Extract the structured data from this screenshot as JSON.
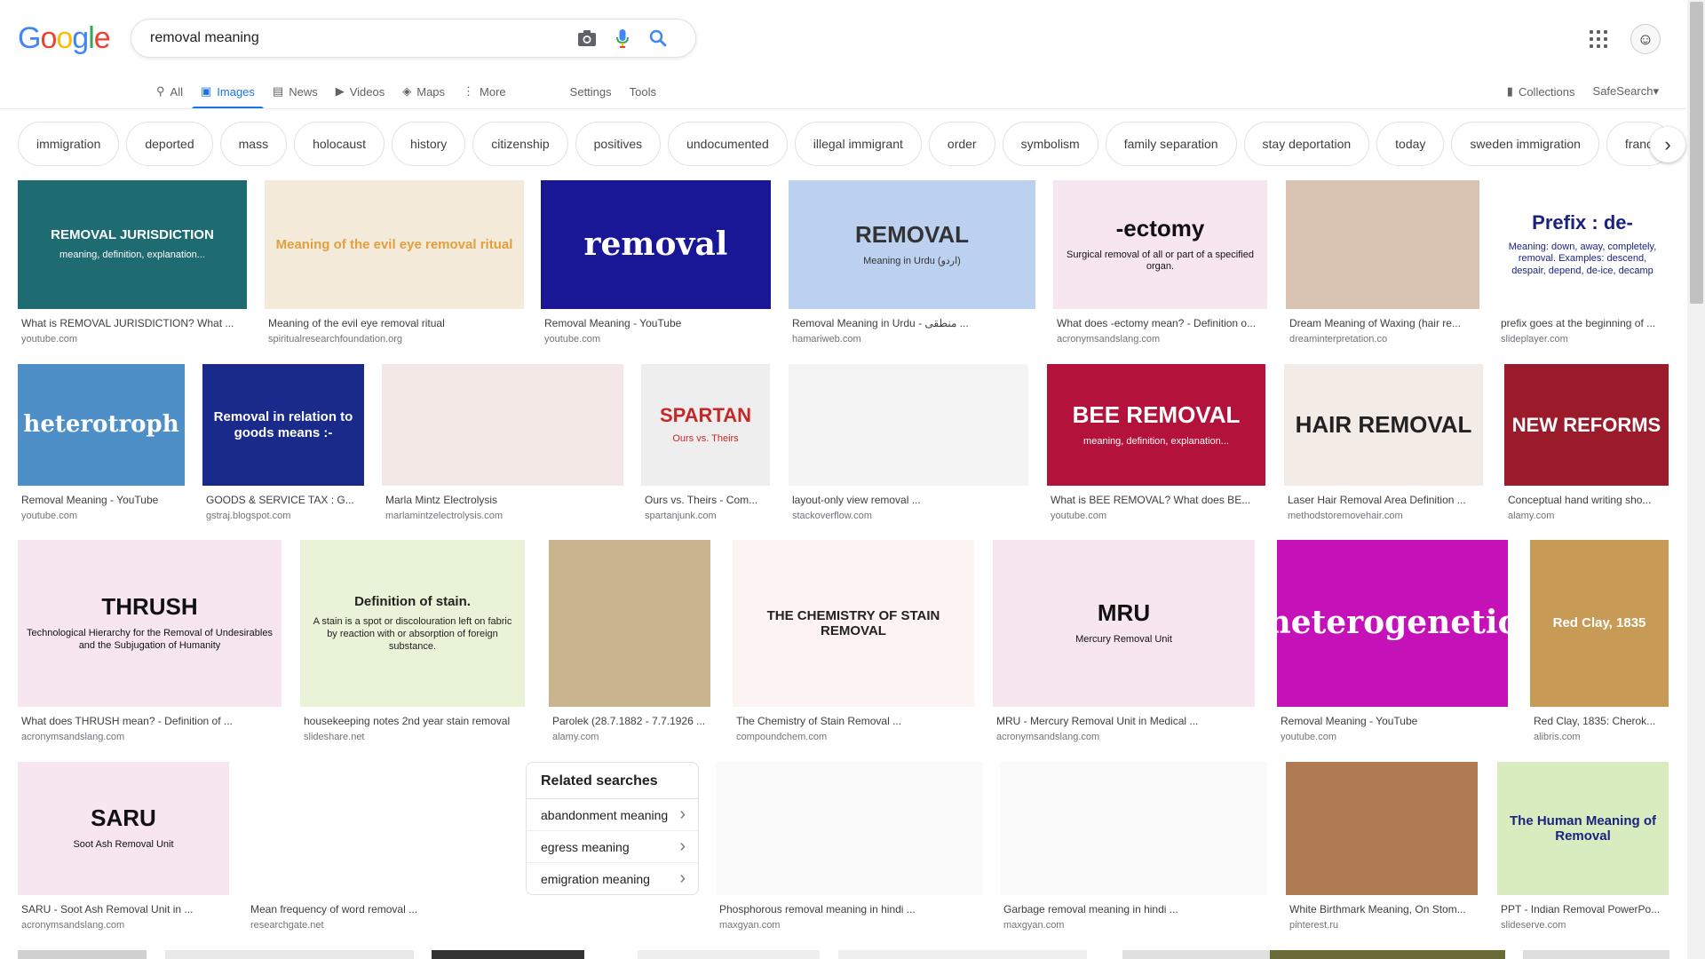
{
  "search": {
    "query": "removal meaning"
  },
  "logo": {
    "letters": [
      {
        "ch": "G",
        "color": "#4285F4"
      },
      {
        "ch": "o",
        "color": "#EA4335"
      },
      {
        "ch": "o",
        "color": "#FBBC05"
      },
      {
        "ch": "g",
        "color": "#4285F4"
      },
      {
        "ch": "l",
        "color": "#34A853"
      },
      {
        "ch": "e",
        "color": "#EA4335"
      }
    ]
  },
  "tabs": {
    "all": "All",
    "images": "Images",
    "news": "News",
    "videos": "Videos",
    "maps": "Maps",
    "more": "More",
    "settings": "Settings",
    "tools": "Tools",
    "collections": "Collections",
    "safesearch": "SafeSearch"
  },
  "chips": [
    "immigration",
    "deported",
    "mass",
    "holocaust",
    "history",
    "citizenship",
    "positives",
    "undocumented",
    "illegal immigrant",
    "order",
    "symbolism",
    "family separation",
    "stay deportation",
    "today",
    "sweden immigration",
    "franc"
  ],
  "results": [
    {
      "title": "What is REMOVAL JURISDICTION? What ...",
      "site": "youtube.com",
      "thumb_text": "REMOVAL JURISDICTION",
      "thumb_sub": "meaning, definition, explanation...",
      "bg": "#1f6b72",
      "fg": "#ffffff"
    },
    {
      "title": "Meaning of the evil eye removal ritual",
      "site": "spiritualresearchfoundation.org",
      "thumb_text": "Meaning of the evil eye removal ritual",
      "thumb_sub": "",
      "bg": "#f3ead9",
      "fg": "#e0a040"
    },
    {
      "title": "Removal Meaning - YouTube",
      "site": "youtube.com",
      "thumb_text": "removal",
      "thumb_sub": "",
      "bg": "#1a1796",
      "fg": "#ffffff"
    },
    {
      "title": "Removal Meaning in Urdu - منطقی ...",
      "site": "hamariweb.com",
      "thumb_text": "REMOVAL",
      "thumb_sub": "Meaning in Urdu (اردو)",
      "bg": "#bcd0f0",
      "fg": "#333333"
    },
    {
      "title": "What does -ectomy mean? - Definition o...",
      "site": "acronymsandslang.com",
      "thumb_text": "-ectomy",
      "thumb_sub": "Surgical removal of all or part of a specified organ.",
      "bg": "#f7e6ef",
      "fg": "#111111"
    },
    {
      "title": "Dream Meaning of Waxing (hair re...",
      "site": "dreaminterpretation.co",
      "thumb_text": "",
      "thumb_sub": "",
      "bg": "#d9c3b2",
      "fg": "#333333"
    },
    {
      "title": "prefix goes at the beginning of ...",
      "site": "slideplayer.com",
      "thumb_text": "Prefix : de-",
      "thumb_sub": "Meaning: down, away, completely, removal. Examples: descend, despair, depend, de-ice, decamp",
      "bg": "#ffffff",
      "fg": "#1a237e"
    },
    {
      "title": "Removal Meaning - YouTube",
      "site": "youtube.com",
      "thumb_text": "heterotroph",
      "thumb_sub": "",
      "bg": "#4f8fc7",
      "fg": "#ffffff"
    },
    {
      "title": "GOODS & SERVICE TAX : G...",
      "site": "gstraj.blogspot.com",
      "thumb_text": "Removal in relation to goods means :-",
      "thumb_sub": "",
      "bg": "#1a2a8a",
      "fg": "#ffffff"
    },
    {
      "title": "Marla Mintz Electrolysis",
      "site": "marlamintzelectrolysis.com",
      "thumb_text": "",
      "thumb_sub": "",
      "bg": "#f3e8e6",
      "fg": "#555555"
    },
    {
      "title": "Ours vs. Theirs - Com...",
      "site": "spartanjunk.com",
      "thumb_text": "SPARTAN",
      "thumb_sub": "Ours vs. Theirs",
      "bg": "#eeeeee",
      "fg": "#c62828"
    },
    {
      "title": "layout-only view removal ...",
      "site": "stackoverflow.com",
      "thumb_text": "",
      "thumb_sub": "",
      "bg": "#f4f4f4",
      "fg": "#555555"
    },
    {
      "title": "What is BEE REMOVAL? What does BE...",
      "site": "youtube.com",
      "thumb_text": "BEE REMOVAL",
      "thumb_sub": "meaning, definition, explanation...",
      "bg": "#b3123a",
      "fg": "#ffffff"
    },
    {
      "title": "Laser Hair Removal Area Definition ...",
      "site": "methodstoremovehair.com",
      "thumb_text": "HAIR REMOVAL",
      "thumb_sub": "",
      "bg": "#f3ebe6",
      "fg": "#222222"
    },
    {
      "title": "Conceptual hand writing sho...",
      "site": "alamy.com",
      "thumb_text": "NEW REFORMS",
      "thumb_sub": "",
      "bg": "#9b1b2a",
      "fg": "#ffffff"
    },
    {
      "title": "What does THRUSH mean? - Definition of ...",
      "site": "acronymsandslang.com",
      "thumb_text": "THRUSH",
      "thumb_sub": "Technological Hierarchy for the Removal of Undesirables and the Subjugation of Humanity",
      "bg": "#f7e6ef",
      "fg": "#111111"
    },
    {
      "title": "housekeeping notes 2nd year stain removal",
      "site": "slideshare.net",
      "thumb_text": "Definition of stain.",
      "thumb_sub": "A stain is a spot or discolouration left on fabric by reaction with or absorption of foreign substance.",
      "bg": "#e8f3d8",
      "fg": "#222222"
    },
    {
      "title": "Parolek (28.7.1882 - 7.7.1926 ...",
      "site": "alamy.com",
      "thumb_text": "",
      "thumb_sub": "",
      "bg": "#c9b48e",
      "fg": "#333333"
    },
    {
      "title": "The Chemistry of Stain Removal ...",
      "site": "compoundchem.com",
      "thumb_text": "THE CHEMISTRY OF STAIN REMOVAL",
      "thumb_sub": "",
      "bg": "#fdf3f3",
      "fg": "#222222"
    },
    {
      "title": "MRU - Mercury Removal Unit in Medical ...",
      "site": "acronymsandslang.com",
      "thumb_text": "MRU",
      "thumb_sub": "Mercury Removal Unit",
      "bg": "#f7e6ef",
      "fg": "#111111"
    },
    {
      "title": "Removal Meaning - YouTube",
      "site": "youtube.com",
      "thumb_text": "heterogenetic",
      "thumb_sub": "",
      "bg": "#c511b8",
      "fg": "#ffffff"
    },
    {
      "title": "Red Clay, 1835: Cherok...",
      "site": "alibris.com",
      "thumb_text": "Red Clay, 1835",
      "thumb_sub": "",
      "bg": "#c79a55",
      "fg": "#ffffff"
    },
    {
      "title": "SARU - Soot Ash Removal Unit in ...",
      "site": "acronymsandslang.com",
      "thumb_text": "SARU",
      "thumb_sub": "Soot Ash Removal Unit",
      "bg": "#f7e6ef",
      "fg": "#111111"
    },
    {
      "title": "Mean frequency of word removal ...",
      "site": "researchgate.net",
      "thumb_text": "",
      "thumb_sub": "",
      "bg": "#ffffff",
      "fg": "#333333"
    },
    {
      "title": "Phosphorous removal meaning in hindi ...",
      "site": "maxgyan.com",
      "thumb_text": "",
      "thumb_sub": "",
      "bg": "#fafafa",
      "fg": "#333333"
    },
    {
      "title": "Garbage removal meaning in hindi ...",
      "site": "maxgyan.com",
      "thumb_text": "",
      "thumb_sub": "",
      "bg": "#fafafa",
      "fg": "#333333"
    },
    {
      "title": "White Birthmark Meaning, On Stom...",
      "site": "pinterest.ru",
      "thumb_text": "",
      "thumb_sub": "",
      "bg": "#b07a52",
      "fg": "#333333"
    },
    {
      "title": "PPT - Indian Removal PowerPo...",
      "site": "slideserve.com",
      "thumb_text": "The Human Meaning of Removal",
      "thumb_sub": "",
      "bg": "#d8ecc0",
      "fg": "#1a237e"
    }
  ],
  "related": {
    "heading": "Related searches",
    "items": [
      "abandonment meaning",
      "egress meaning",
      "emigration meaning"
    ]
  }
}
